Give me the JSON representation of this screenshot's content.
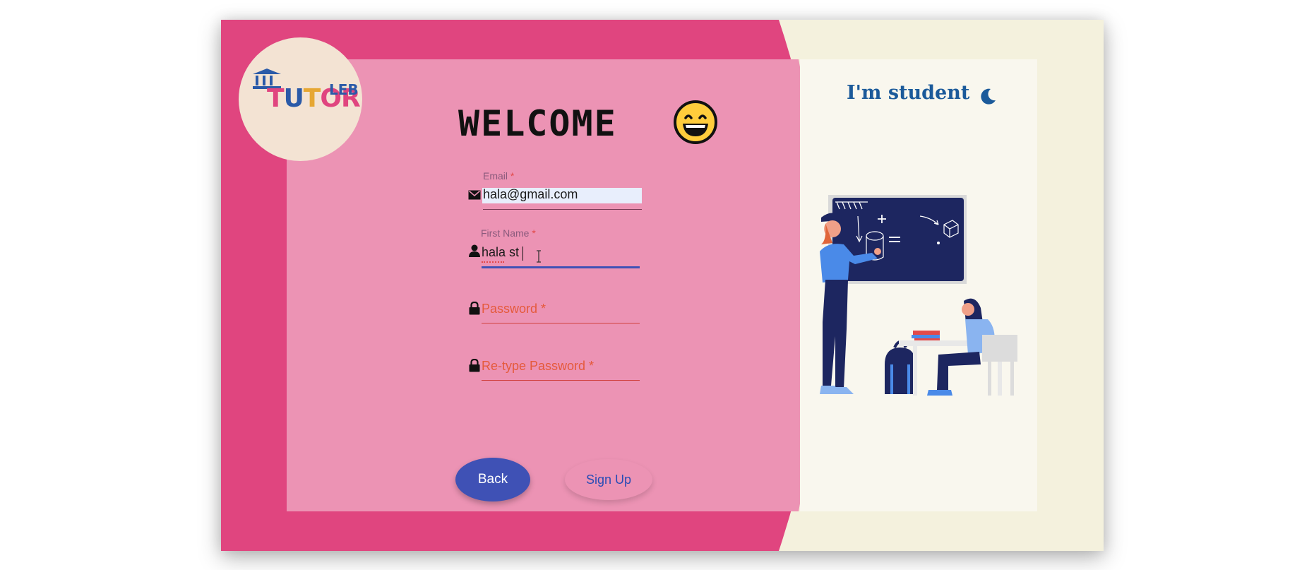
{
  "logo": {
    "text_parts": [
      "T",
      "U",
      "T",
      "O",
      "R"
    ],
    "superscript": "LEB"
  },
  "header": {
    "welcome": "WELCOME",
    "emoji_icon": "grinning-face-icon"
  },
  "role": {
    "label": "I'm student",
    "theme_toggle_icon": "moon-icon"
  },
  "form": {
    "email": {
      "label": "Email",
      "required": "*",
      "value": "hala@gmail.com",
      "icon": "envelope-icon"
    },
    "first_name": {
      "label": "First Name",
      "required": "*",
      "value": "hala st",
      "icon": "user-icon"
    },
    "password": {
      "placeholder": "Password *",
      "icon": "lock-icon"
    },
    "retype_password": {
      "placeholder": "Re-type Password *",
      "icon": "lock-icon"
    }
  },
  "buttons": {
    "back": "Back",
    "signup": "Sign Up"
  },
  "colors": {
    "primary_pink": "#e0457f",
    "light_pink": "#ec93b4",
    "cream": "#f4f1dd",
    "accent_blue": "#3f51b5",
    "title_blue": "#1b5a9a",
    "error_red": "#e55a3c"
  }
}
